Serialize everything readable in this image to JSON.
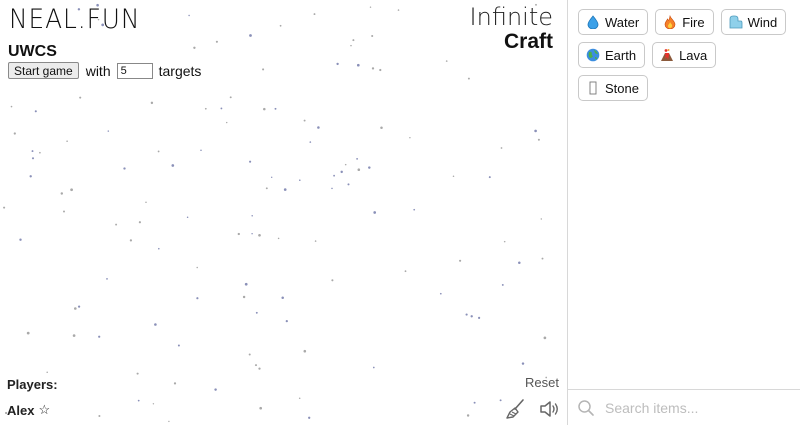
{
  "canvas": {
    "logo": "NEAL.FUN",
    "game_title": "UWCS",
    "start_button": "Start game",
    "with_text": "with",
    "targets_value": "5",
    "targets_text": "targets",
    "brand_top": "Infinite",
    "brand_bottom": "Craft",
    "players_label": "Players:",
    "player_name": "Alex",
    "player_star": "☆",
    "reset_label": "Reset"
  },
  "sidebar": {
    "items": [
      {
        "label": "Water",
        "icon": "droplet-icon"
      },
      {
        "label": "Fire",
        "icon": "fire-icon"
      },
      {
        "label": "Wind",
        "icon": "wind-icon"
      },
      {
        "label": "Earth",
        "icon": "globe-icon"
      },
      {
        "label": "Lava",
        "icon": "volcano-icon"
      },
      {
        "label": "Stone",
        "icon": "stone-icon"
      }
    ],
    "search_placeholder": "Search items..."
  }
}
